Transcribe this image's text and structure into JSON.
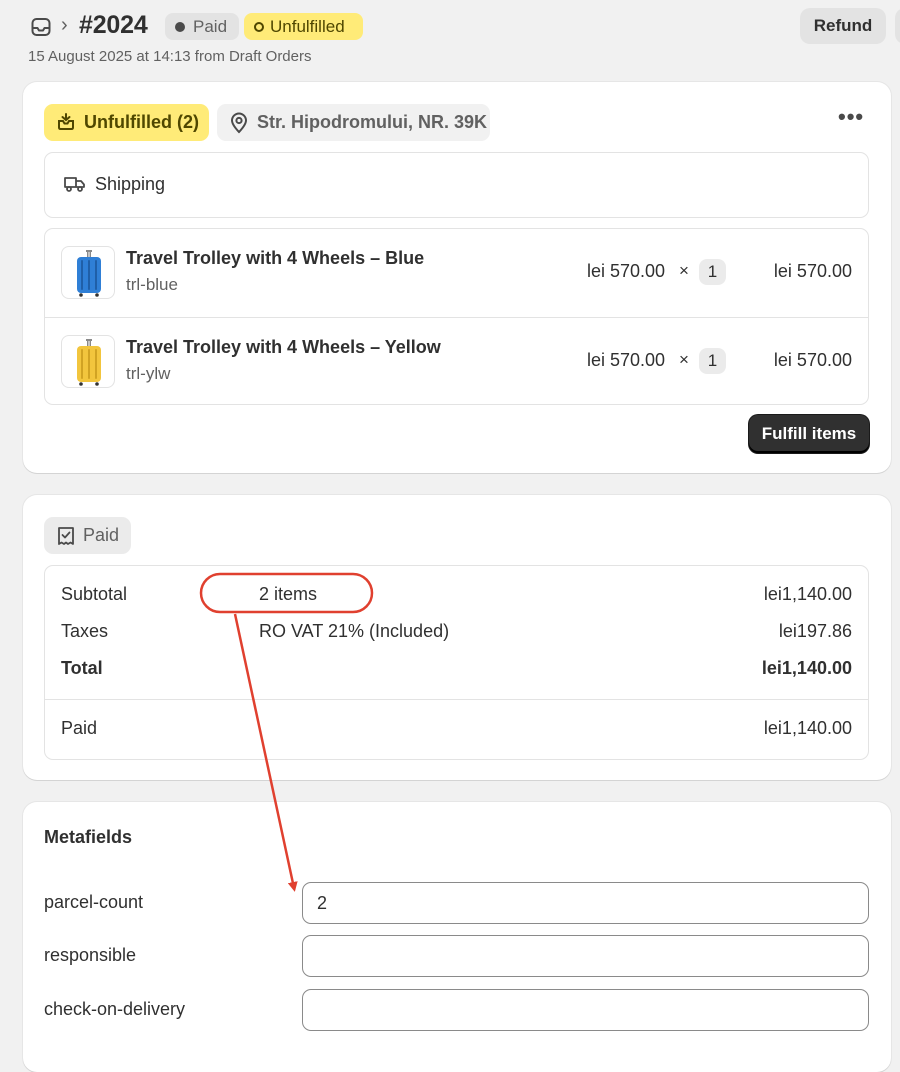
{
  "header": {
    "order_number": "#2024",
    "payment_badge": "Paid",
    "fulfillment_badge": "Unfulfilled",
    "subline": "15 August 2025 at 14:13 from Draft Orders",
    "refund_label": "Refund"
  },
  "fulfillment": {
    "status_chip": "Unfulfilled (2)",
    "address_chip": "Str. Hipodromului, NR. 39K",
    "shipping_label": "Shipping",
    "items": [
      {
        "title": "Travel Trolley with 4 Wheels – Blue",
        "sku": "trl-blue",
        "price": "lei 570.00",
        "times": "×",
        "qty": "1",
        "total": "lei 570.00",
        "color": "#2f7fd6"
      },
      {
        "title": "Travel Trolley with 4 Wheels – Yellow",
        "sku": "trl-ylw",
        "price": "lei 570.00",
        "times": "×",
        "qty": "1",
        "total": "lei 570.00",
        "color": "#f2c53d"
      }
    ],
    "fulfill_button": "Fulfill items"
  },
  "payment": {
    "status_chip": "Paid",
    "rows": {
      "subtotal": {
        "label": "Subtotal",
        "desc": "2 items",
        "amount": "lei1,140.00"
      },
      "taxes": {
        "label": "Taxes",
        "desc": "RO VAT 21% (Included)",
        "amount": "lei197.86"
      },
      "total": {
        "label": "Total",
        "amount": "lei1,140.00"
      },
      "paid": {
        "label": "Paid",
        "amount": "lei1,140.00"
      }
    }
  },
  "metafields": {
    "title": "Metafields",
    "fields": [
      {
        "label": "parcel-count",
        "value": "2"
      },
      {
        "label": "responsible",
        "value": ""
      },
      {
        "label": "check-on-delivery",
        "value": ""
      }
    ]
  },
  "colors": {
    "annotation": "#e0402f",
    "unfulfilled_bg": "#ffeb78",
    "primary_button": "#303030"
  }
}
